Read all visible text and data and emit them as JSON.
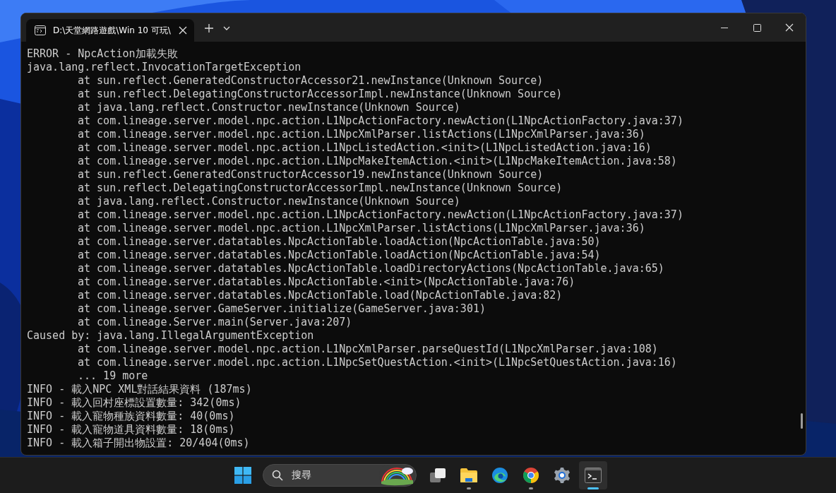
{
  "window": {
    "tab": {
      "title": "D:\\天堂網路遊戲\\Win 10 可玩\\",
      "selected": true
    }
  },
  "console": {
    "lines": [
      {
        "text": "ERROR - NpcAction加載失敗",
        "indented": false
      },
      {
        "text": "java.lang.reflect.InvocationTargetException",
        "indented": false
      },
      {
        "text": "at sun.reflect.GeneratedConstructorAccessor21.newInstance(Unknown Source)",
        "indented": true
      },
      {
        "text": "at sun.reflect.DelegatingConstructorAccessorImpl.newInstance(Unknown Source)",
        "indented": true
      },
      {
        "text": "at java.lang.reflect.Constructor.newInstance(Unknown Source)",
        "indented": true
      },
      {
        "text": "at com.lineage.server.model.npc.action.L1NpcActionFactory.newAction(L1NpcActionFactory.java:37)",
        "indented": true
      },
      {
        "text": "at com.lineage.server.model.npc.action.L1NpcXmlParser.listActions(L1NpcXmlParser.java:36)",
        "indented": true
      },
      {
        "text": "at com.lineage.server.model.npc.action.L1NpcListedAction.<init>(L1NpcListedAction.java:16)",
        "indented": true
      },
      {
        "text": "at com.lineage.server.model.npc.action.L1NpcMakeItemAction.<init>(L1NpcMakeItemAction.java:58)",
        "indented": true
      },
      {
        "text": "at sun.reflect.GeneratedConstructorAccessor19.newInstance(Unknown Source)",
        "indented": true
      },
      {
        "text": "at sun.reflect.DelegatingConstructorAccessorImpl.newInstance(Unknown Source)",
        "indented": true
      },
      {
        "text": "at java.lang.reflect.Constructor.newInstance(Unknown Source)",
        "indented": true
      },
      {
        "text": "at com.lineage.server.model.npc.action.L1NpcActionFactory.newAction(L1NpcActionFactory.java:37)",
        "indented": true
      },
      {
        "text": "at com.lineage.server.model.npc.action.L1NpcXmlParser.listActions(L1NpcXmlParser.java:36)",
        "indented": true
      },
      {
        "text": "at com.lineage.server.datatables.NpcActionTable.loadAction(NpcActionTable.java:50)",
        "indented": true
      },
      {
        "text": "at com.lineage.server.datatables.NpcActionTable.loadAction(NpcActionTable.java:54)",
        "indented": true
      },
      {
        "text": "at com.lineage.server.datatables.NpcActionTable.loadDirectoryActions(NpcActionTable.java:65)",
        "indented": true
      },
      {
        "text": "at com.lineage.server.datatables.NpcActionTable.<init>(NpcActionTable.java:76)",
        "indented": true
      },
      {
        "text": "at com.lineage.server.datatables.NpcActionTable.load(NpcActionTable.java:82)",
        "indented": true
      },
      {
        "text": "at com.lineage.server.GameServer.initialize(GameServer.java:301)",
        "indented": true
      },
      {
        "text": "at com.lineage.Server.main(Server.java:207)",
        "indented": true
      },
      {
        "text": "Caused by: java.lang.IllegalArgumentException",
        "indented": false
      },
      {
        "text": "at com.lineage.server.model.npc.action.L1NpcXmlParser.parseQuestId(L1NpcXmlParser.java:108)",
        "indented": true
      },
      {
        "text": "at com.lineage.server.model.npc.action.L1NpcSetQuestAction.<init>(L1NpcSetQuestAction.java:16)",
        "indented": true
      },
      {
        "text": "... 19 more",
        "indented": true
      },
      {
        "text": "INFO - 載入NPC XML對話結果資料 (187ms)",
        "indented": false
      },
      {
        "text": "INFO - 載入回村座標設置數量: 342(0ms)",
        "indented": false
      },
      {
        "text": "INFO - 載入寵物種族資料數量: 40(0ms)",
        "indented": false
      },
      {
        "text": "INFO - 載入寵物道具資料數量: 18(0ms)",
        "indented": false
      },
      {
        "text": "INFO - 載入箱子開出物設置: 20/404(0ms)",
        "indented": false
      }
    ]
  },
  "taskbar": {
    "search": {
      "placeholder": "搜尋"
    },
    "apps": [
      {
        "kind": "taskview",
        "running": false,
        "selected": false
      },
      {
        "kind": "folder",
        "running": true,
        "selected": false
      },
      {
        "kind": "edge",
        "running": false,
        "selected": false
      },
      {
        "kind": "chrome",
        "running": true,
        "selected": false
      },
      {
        "kind": "settings",
        "running": false,
        "selected": false
      },
      {
        "kind": "terminal",
        "running": true,
        "selected": true
      }
    ]
  }
}
